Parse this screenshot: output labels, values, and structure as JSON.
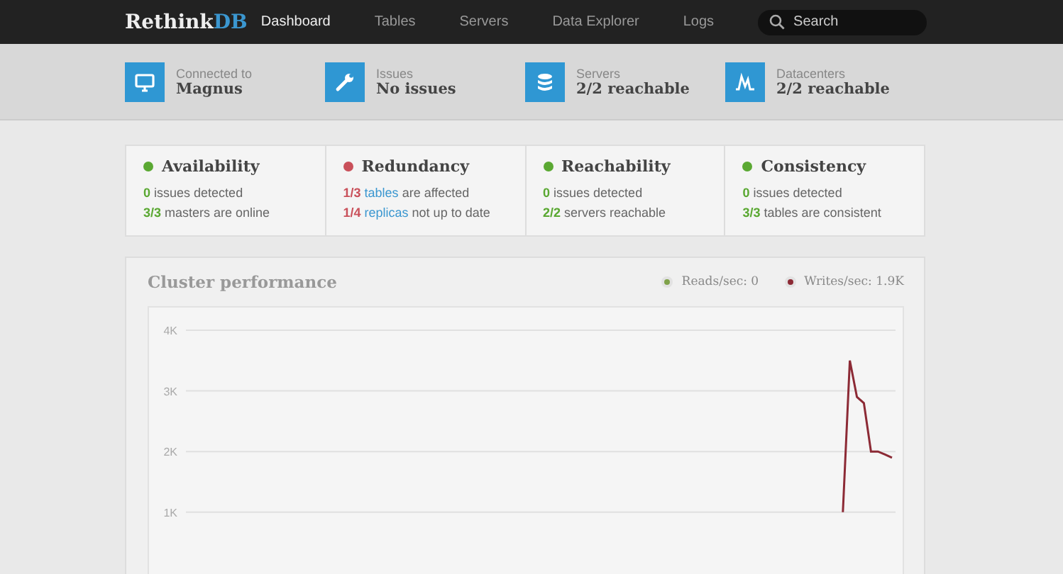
{
  "logo": {
    "text": "Rethink",
    "accent": "DB"
  },
  "nav": [
    {
      "label": "Dashboard",
      "selected": true
    },
    {
      "label": "Tables",
      "selected": false
    },
    {
      "label": "Servers",
      "selected": false
    },
    {
      "label": "Data Explorer",
      "selected": false
    },
    {
      "label": "Logs",
      "selected": false
    }
  ],
  "search": {
    "placeholder": "Search"
  },
  "status": [
    {
      "kind": "monitor",
      "label": "Connected to",
      "value": "Magnus"
    },
    {
      "kind": "wrench",
      "label": "Issues",
      "value": "No issues"
    },
    {
      "kind": "database",
      "label": "Servers",
      "value": "2/2 reachable"
    },
    {
      "kind": "pulse",
      "label": "Datacenters",
      "value": "2/2 reachable"
    }
  ],
  "issues": [
    {
      "title": "Availability",
      "color": "#5aa832",
      "lines": [
        {
          "count": "0",
          "text": "issues detected"
        },
        {
          "count": "3/3",
          "text": "masters are online"
        }
      ]
    },
    {
      "title": "Redundancy",
      "color": "#c9505a",
      "lines": [
        {
          "count": "1/3",
          "link": "tables",
          "text": "are affected"
        },
        {
          "count": "1/4",
          "link": "replicas",
          "text": "not up to date"
        }
      ]
    },
    {
      "title": "Reachability",
      "color": "#5aa832",
      "lines": [
        {
          "count": "0",
          "text": "issues detected"
        },
        {
          "count": "2/2",
          "text": "servers reachable"
        }
      ]
    },
    {
      "title": "Consistency",
      "color": "#5aa832",
      "lines": [
        {
          "count": "0",
          "text": "issues detected"
        },
        {
          "count": "3/3",
          "text": "tables are consistent"
        }
      ]
    }
  ],
  "performance": {
    "title": "Cluster performance",
    "legend": [
      {
        "label": "Reads/sec: 0",
        "color": "#7fa24a"
      },
      {
        "label": "Writes/sec: 1.9K",
        "color": "#8c2a35"
      }
    ],
    "chart_data": {
      "type": "line",
      "categories": [
        null,
        null,
        null,
        null,
        null,
        null,
        null,
        null,
        null,
        null,
        null,
        null,
        null,
        null,
        null,
        null,
        null,
        null,
        null,
        null,
        null,
        null,
        null,
        null,
        null,
        null,
        null,
        null,
        null,
        null,
        null,
        null,
        null,
        null,
        null,
        null,
        null,
        null,
        null,
        null,
        null,
        null,
        null,
        null,
        null,
        null,
        null,
        null,
        null,
        null,
        null,
        null,
        null,
        null,
        null,
        null,
        null,
        null,
        null,
        null,
        null,
        null,
        null,
        null,
        null,
        null,
        null,
        null,
        null,
        null,
        null,
        null,
        null,
        null,
        null,
        null,
        null,
        null,
        null,
        null,
        null,
        null,
        null,
        null,
        null,
        null,
        null,
        null,
        null,
        null,
        null,
        null,
        null,
        null,
        null,
        null,
        null,
        null,
        null,
        null,
        null
      ],
      "grid": true,
      "ylim": [
        1000,
        4000
      ],
      "yticks": [
        {
          "value": 1000,
          "label": "1K"
        },
        {
          "value": 2000,
          "label": "2K"
        },
        {
          "value": 3000,
          "label": "3K"
        },
        {
          "value": 4000,
          "label": "4K"
        }
      ],
      "series": [
        {
          "color": "#8c2a35",
          "values": [
            null,
            null,
            null,
            null,
            null,
            null,
            null,
            null,
            null,
            null,
            null,
            null,
            null,
            null,
            null,
            null,
            null,
            null,
            null,
            null,
            null,
            null,
            null,
            null,
            null,
            null,
            null,
            null,
            null,
            null,
            null,
            null,
            null,
            null,
            null,
            null,
            null,
            null,
            null,
            null,
            null,
            null,
            null,
            null,
            null,
            null,
            null,
            null,
            null,
            null,
            null,
            null,
            null,
            null,
            null,
            null,
            null,
            null,
            null,
            null,
            null,
            null,
            null,
            null,
            null,
            null,
            null,
            null,
            null,
            null,
            null,
            null,
            null,
            null,
            null,
            null,
            null,
            null,
            null,
            null,
            null,
            null,
            null,
            null,
            null,
            null,
            null,
            null,
            null,
            null,
            null,
            null,
            null,
            1000,
            3500,
            2900,
            2800,
            2000,
            2000,
            1950,
            1900
          ]
        }
      ]
    }
  }
}
